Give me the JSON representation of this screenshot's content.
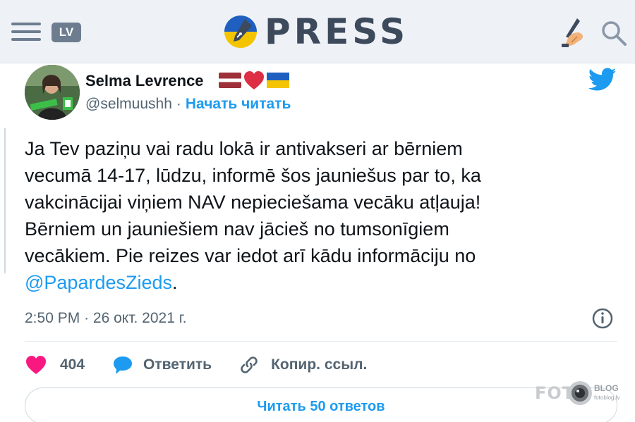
{
  "header": {
    "menu_icon": "hamburger-menu-icon",
    "lang": "LV",
    "logo_text": "PRESS",
    "pen_icon": "writing-hand-icon",
    "search_icon": "search-icon",
    "colors": {
      "background": "#eef2f7",
      "logo_text": "#3d4a5c",
      "ukraine_blue": "#1f5fbf",
      "ukraine_yellow": "#f5c400"
    }
  },
  "tweet": {
    "author": {
      "name": "Selma Levrence",
      "handle": "@selmuushh",
      "separator": "·",
      "follow_label": "Начать читать",
      "flags": [
        "latvia-flag-icon",
        "red-heart-icon",
        "ukraine-flag-icon"
      ]
    },
    "text_line_1": "Ja Tev paziņu vai radu lokā ir antivakseri ar bērniem",
    "text_line_2": "vecumā 14-17, lūdzu, informē šos jauniešus par to, ka",
    "text_line_3": "vakcinācijai viņiem NAV nepieciešama vecāku atļauja!",
    "text_line_4": "Bērniem un jauniešiem nav jācieš no tumsonīgiem",
    "text_line_5": "vecākiem. Pie reizes var iedot arī kādu informāciju no",
    "mention": "@PapardesZieds",
    "mention_suffix": ".",
    "time": "2:50 PM",
    "date_separator": "·",
    "date": "26 окт. 2021 г.",
    "actions": {
      "likes": "404",
      "reply_label": "Ответить",
      "copy_label": "Копир. ссыл."
    },
    "read_replies_label": "Читать 50 ответов",
    "colors": {
      "accent": "#1d9bf0",
      "like": "#f91880",
      "muted": "#536471"
    }
  },
  "watermark": {
    "foto": "FOTO",
    "blog": "BLOG",
    "site": "fotoblog.lv"
  }
}
